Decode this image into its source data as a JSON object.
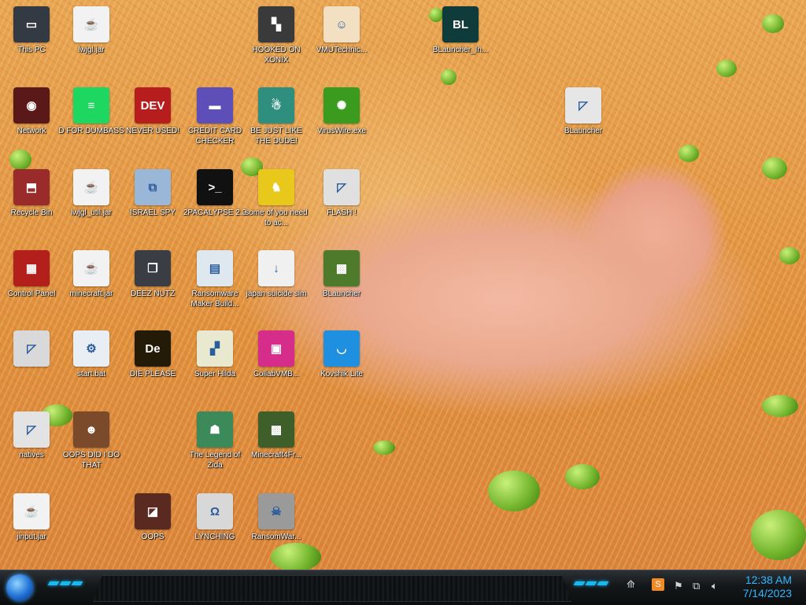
{
  "desktop": {
    "icons": [
      {
        "label": "This PC",
        "icon": "computer-icon",
        "color": "#333a44",
        "mark": "▭"
      },
      {
        "label": "lwjgl.jar",
        "icon": "java-jar-icon",
        "color": "#f2f2f2",
        "mark": "☕"
      },
      {
        "label": "HOOKED ON XONIX",
        "icon": "xonix-game-icon",
        "color": "#3a3a3a",
        "mark": "▚"
      },
      {
        "label": "VMUTechnic...",
        "icon": "technician-icon",
        "color": "#f3e0c2",
        "mark": "☺"
      },
      {
        "label": "BLauncher_In...",
        "icon": "blauncher-installer-icon",
        "color": "#0f3b3a",
        "mark": "BL"
      },
      {
        "label": "Network",
        "icon": "network-icon",
        "color": "#5b1818",
        "mark": "◉"
      },
      {
        "label": "D FOR DUMBASS",
        "icon": "green-app-icon",
        "color": "#1ed760",
        "mark": "≡"
      },
      {
        "label": "NEVER USED!",
        "icon": "devcpp-icon",
        "color": "#b81d1d",
        "mark": "DEV"
      },
      {
        "label": "CREDIT CARD CHECKER",
        "icon": "credit-card-icon",
        "color": "#5e4fb8",
        "mark": "▬"
      },
      {
        "label": "BE JUST LIKE THE DUDE!",
        "icon": "dude-icon",
        "color": "#2f8f7f",
        "mark": "☃"
      },
      {
        "label": "VirusWire.exe",
        "icon": "lime-icon",
        "color": "#3b9b1f",
        "mark": "✺"
      },
      {
        "label": "BLauncher",
        "icon": "shortcut-file-icon",
        "color": "#e6e6e6",
        "mark": "◸"
      },
      {
        "label": "Recycle Bin",
        "icon": "recycle-bin-icon",
        "color": "#9a2b2b",
        "mark": "⬒"
      },
      {
        "label": "lwjgl_util.jar",
        "icon": "java-jar-icon",
        "color": "#f2f2f2",
        "mark": "☕"
      },
      {
        "label": "ISRAEL SPY",
        "icon": "spy-network-icon",
        "color": "#9bb7d8",
        "mark": "⧉"
      },
      {
        "label": "2PACALYPSE 2.3",
        "icon": "terminal-icon",
        "color": "#111111",
        "mark": ">_"
      },
      {
        "label": "some of you need to ac...",
        "icon": "moose-icon",
        "color": "#e8c81a",
        "mark": "♞"
      },
      {
        "label": "FLASH !",
        "icon": "flash-file-icon",
        "color": "#e0e0e0",
        "mark": "◸"
      },
      {
        "label": "Control Panel",
        "icon": "control-panel-icon",
        "color": "#b3201c",
        "mark": "▦"
      },
      {
        "label": "minecraft.jar",
        "icon": "java-jar-icon",
        "color": "#f2f2f2",
        "mark": "☕"
      },
      {
        "label": "DEEZ NUTZ",
        "icon": "stacked-windows-icon",
        "color": "#3a3e44",
        "mark": "❐"
      },
      {
        "label": "Ransomware Maker Build...",
        "icon": "ransomware-builder-icon",
        "color": "#dfe8ee",
        "mark": "▤"
      },
      {
        "label": "japan suicide sim",
        "icon": "japan-sim-icon",
        "color": "#f0f0f0",
        "mark": "↓"
      },
      {
        "label": "BLauncher",
        "icon": "grass-block-icon",
        "color": "#4e7a2c",
        "mark": "▩"
      },
      {
        "label": "",
        "icon": "blank-file-icon",
        "color": "#d9d9d9",
        "mark": "◸"
      },
      {
        "label": "start.bat",
        "icon": "batch-file-icon",
        "color": "#e8eef4",
        "mark": "⚙"
      },
      {
        "label": "DIE PLEASE",
        "icon": "dreamweaver-icon",
        "color": "#241a08",
        "mark": "De"
      },
      {
        "label": "Super Hilda",
        "icon": "pixel-cat-icon",
        "color": "#e9e9d0",
        "mark": "▞"
      },
      {
        "label": "CollabVMB...",
        "icon": "monitor-icon",
        "color": "#d62c8a",
        "mark": "▣"
      },
      {
        "label": "Kovshik Lite",
        "icon": "blue-ladle-icon",
        "color": "#1f8fe0",
        "mark": "◡"
      },
      {
        "label": "natives",
        "icon": "folder-icon",
        "color": "#e3e3e3",
        "mark": "◸"
      },
      {
        "label": "OOPS DID I DO THAT",
        "icon": "portrait-icon",
        "color": "#7a4a2a",
        "mark": "☻"
      },
      {
        "label": "The Legend of Zida",
        "icon": "pixel-hero-icon",
        "color": "#3c8a5a",
        "mark": "☗"
      },
      {
        "label": "Minecraft4Fr...",
        "icon": "minecraft-block-icon",
        "color": "#3f5f2a",
        "mark": "▩"
      },
      {
        "label": "jinput.jar",
        "icon": "java-jar-icon",
        "color": "#f2f2f2",
        "mark": "☕"
      },
      {
        "label": "OOPS",
        "icon": "brown-box-icon",
        "color": "#5a2a20",
        "mark": "◪"
      },
      {
        "label": "LYNCHING",
        "icon": "noose-icon",
        "color": "#d8d8d8",
        "mark": "Ω"
      },
      {
        "label": "RansomWar...",
        "icon": "skull-icon",
        "color": "#9a9a9a",
        "mark": "☠"
      }
    ]
  },
  "taskbar": {
    "start_icon": "orb-start-icon",
    "tray": {
      "sublime_icon": "sublime-text-icon",
      "flag_icon": "action-center-flag-icon",
      "network_icon": "network-tray-icon",
      "volume_icon": "volume-icon",
      "time": "12:38 AM",
      "date": "7/14/2023"
    }
  },
  "colors": {
    "clock": "#2fb7ff",
    "accent": "#19b8f0"
  }
}
